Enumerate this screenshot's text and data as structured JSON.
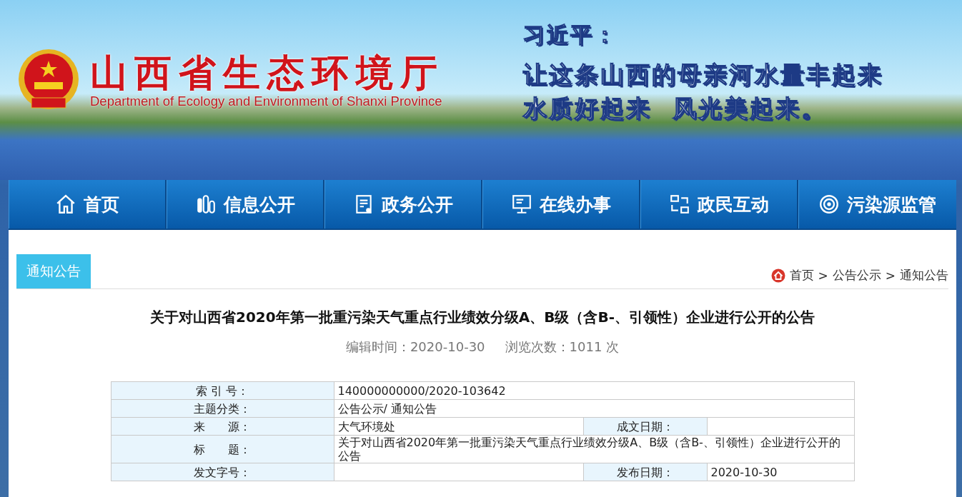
{
  "header": {
    "title": "山西省生态环境厅",
    "subtitle": "Department of Ecology and Environment of Shanxi Province",
    "quote_by": "习近平：",
    "quote_lines": [
      "让这条山西的母亲河水量丰起来",
      "水质好起来  风光美起来。"
    ]
  },
  "nav": [
    {
      "kind": "home",
      "label": "首页"
    },
    {
      "kind": "bars",
      "label": "信息公开"
    },
    {
      "kind": "document",
      "label": "政务公开"
    },
    {
      "kind": "monitor",
      "label": "在线办事"
    },
    {
      "kind": "exchange",
      "label": "政民互动"
    },
    {
      "kind": "target",
      "label": "污染源监管"
    }
  ],
  "section_tab": "通知公告",
  "breadcrumb": [
    "首页",
    "公告公示",
    "通知公告"
  ],
  "breadcrumb_separator": ">",
  "article": {
    "title": "关于对山西省2020年第一批重污染天气重点行业绩效分级A、B级（含B-、引领性）企业进行公开的公告",
    "edit_time": "编辑时间：2020-10-30",
    "views": "浏览次数：1011 次"
  },
  "info_table": [
    {
      "label": "索 引 号：",
      "value": "140000000000/2020-103642"
    },
    {
      "label": "主题分类：",
      "value": " 公告公示/ 通知公告"
    },
    {
      "label": "来　　源：",
      "value": "大气环境处",
      "label_2": "成文日期："
    },
    {
      "label": "标　　题：",
      "value": "关于对山西省2020年第一批重污染天气重点行业绩效分级A、B级（含B-、引领性）企业进行公开的公告"
    },
    {
      "label": "发文字号：",
      "label_2": "发布日期：",
      "value_2": "2020-10-30"
    }
  ]
}
